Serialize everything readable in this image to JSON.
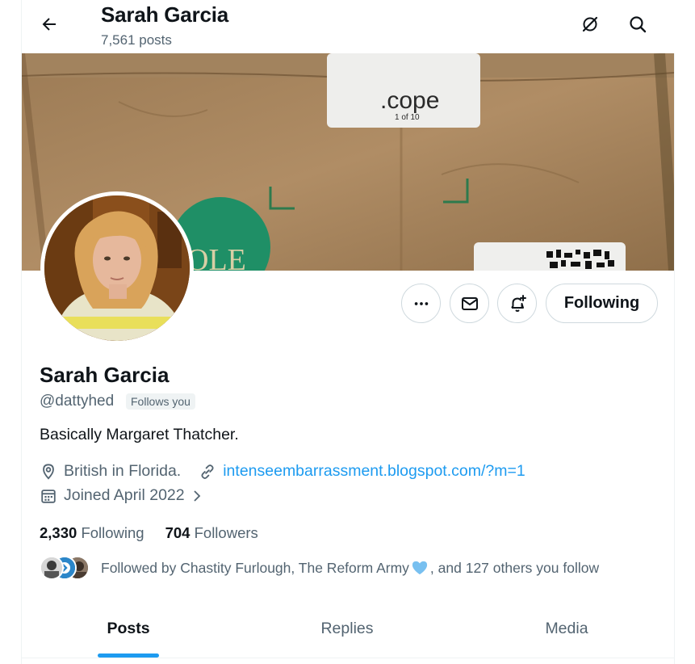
{
  "header": {
    "title": "Sarah Garcia",
    "posts_count": "7,561 posts"
  },
  "banner": {
    "label_text": ".cope",
    "label_sub": "1 of 10",
    "sticker_text": "OLE"
  },
  "actions": {
    "more_icon": "more-horizontal-icon",
    "message_icon": "envelope-icon",
    "notify_icon": "bell-plus-icon",
    "follow_label": "Following"
  },
  "profile": {
    "name": "Sarah Garcia",
    "handle": "@dattyhed",
    "follows_you": "Follows you",
    "bio": "Basically Margaret Thatcher.",
    "location": "British in Florida.",
    "website": "intenseembarrassment.blogspot.com/?m=1",
    "joined": "Joined April 2022",
    "following_count": "2,330",
    "following_label": "Following",
    "followers_count": "704",
    "followers_label": "Followers",
    "followed_by_prefix": "Followed by Chastity Furlough, The Reform Army",
    "followed_by_suffix": ", and 127 others you follow"
  },
  "tabs": [
    {
      "label": "Posts",
      "active": true
    },
    {
      "label": "Replies",
      "active": false
    },
    {
      "label": "Media",
      "active": false
    }
  ],
  "colors": {
    "accent": "#1d9bf0",
    "secondary_text": "#536471",
    "heart": "#78c0f0"
  }
}
